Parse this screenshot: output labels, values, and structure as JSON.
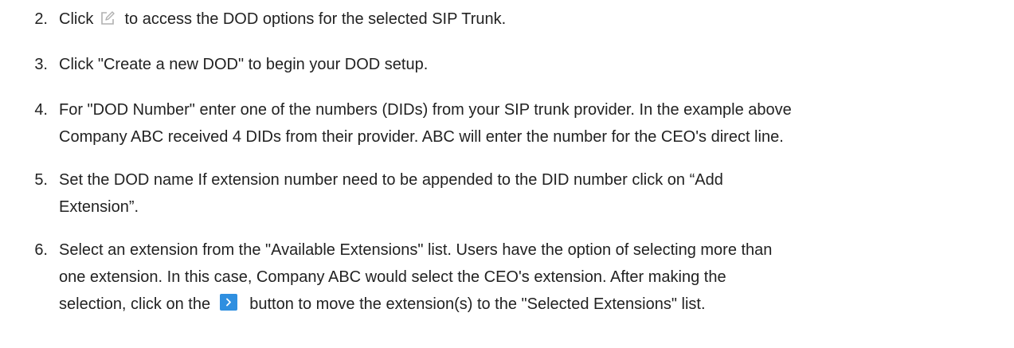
{
  "steps": [
    {
      "number": "2.",
      "before": "Click",
      "icon": "edit-icon",
      "after": "to access the DOD options for the selected SIP Trunk."
    },
    {
      "number": "3.",
      "text": "Click \"Create a new DOD\" to begin your DOD setup."
    },
    {
      "number": "4.",
      "line1": "For \"DOD Number\" enter one of the numbers (DIDs) from your SIP trunk provider. In the example above",
      "line2": "Company ABC received 4 DIDs from their provider. ABC will enter the number for the CEO's direct line."
    },
    {
      "number": "5.",
      "line1": "Set the DOD name If extension number need to be appended to the DID number click on “Add",
      "line2": "Extension”."
    },
    {
      "number": "6.",
      "line1": "Select an extension from the \"Available Extensions\" list. Users have the option of selecting more than",
      "line2": "one extension. In this case, Company ABC would select the CEO's extension. After making the",
      "line3_before": "selection, click on the",
      "icon": "chevron-right-icon",
      "line3_after": "button to move the extension(s) to the \"Selected Extensions\" list."
    }
  ],
  "colors": {
    "text": "#222222",
    "edit_icon": "#b0b0b0",
    "button": "#2f8fe0"
  }
}
